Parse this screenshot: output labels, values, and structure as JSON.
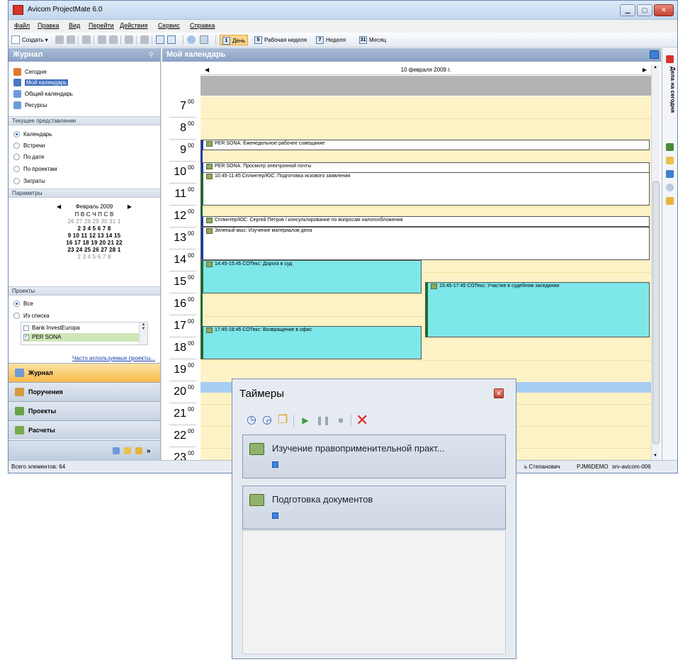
{
  "window": {
    "title": "Avicom ProjectMate 6.0",
    "btn_min": "▁",
    "btn_max": "▢",
    "btn_close": "✕"
  },
  "menu": {
    "file": "Файл",
    "edit": "Правка",
    "view": "Вид",
    "go": "Перейти",
    "actions": "Действия",
    "service": "Сервис",
    "help": "Справка"
  },
  "toolbar": {
    "create": "Создать ▾",
    "day_num": "1",
    "day": "День",
    "workweek_num": "5",
    "workweek": "Рабочая неделя",
    "week_num": "7",
    "week": "Неделя",
    "month_num": "31",
    "month": "Месяц"
  },
  "left_panel": {
    "title": "Журнал",
    "nav": [
      "Сегодня",
      "Мой календарь",
      "Общий календарь",
      "Ресурсы"
    ],
    "current_view_header": "Текущее представление",
    "views": [
      "Календарь",
      "Встречи",
      "По дате",
      "По проектам",
      "Затраты"
    ],
    "params_header": "Параметры",
    "minical": {
      "month": "Февраль 2009",
      "weekdays": "П В С Ч П С В",
      "rows": [
        "26 27 28 29 30 31 1",
        "2 3 4 5 6 7 8",
        "9 10 11 12 13 14 15",
        "16 17 18 19 20 21 22",
        "23 24 25 26 27 28 1",
        "2 3 4 5 6 7 8"
      ]
    },
    "projects_header": "Проекты",
    "proj_all": "Все",
    "proj_list": "Из списка",
    "projects": [
      "Bank InvestEuropa",
      "PER SONA"
    ],
    "freq_link": "Часто используемые проекты...",
    "big_buttons": [
      "Журнал",
      "Поручения",
      "Проекты",
      "Расчеты"
    ]
  },
  "calendar": {
    "title": "Мой календарь",
    "date": "10 февраля 2009 г.",
    "hours": [
      "7",
      "8",
      "9",
      "10",
      "11",
      "12",
      "13",
      "14",
      "15",
      "16",
      "17",
      "18",
      "19",
      "20",
      "21",
      "22",
      "23"
    ],
    "minutes": "00",
    "appointments": [
      "PER SONA:  Еженедельное рабочее совещание",
      "PER SONA:  Просмотр электронной почты",
      "10:45-11:45 Сплинтер/ЮС:  Подготовка искового заявления",
      "Сплинтер/ЮС:  Сергей Петров / консультирование по вопросам налогообложения",
      "Зеленый мыс:  Изучение материалов дела",
      "14:45-15:45 СОТекс:  Дорога в суд",
      "15:45-17:45 СОТекс:  Участие в судебном заседании",
      "17:45-18:45 СОТекс:  Возвращение в офис"
    ]
  },
  "right_bar": {
    "label": "Дела на сегодня"
  },
  "status": {
    "count": "Всего элементов: 64",
    "user": "ь Степанович",
    "db": "PJM6DEMO",
    "server": "srv-avicom-006"
  },
  "timers": {
    "title": "Таймеры",
    "items": [
      {
        "name": "Изучение правоприменительной практ..."
      },
      {
        "name": "Подготовка документов"
      }
    ]
  }
}
